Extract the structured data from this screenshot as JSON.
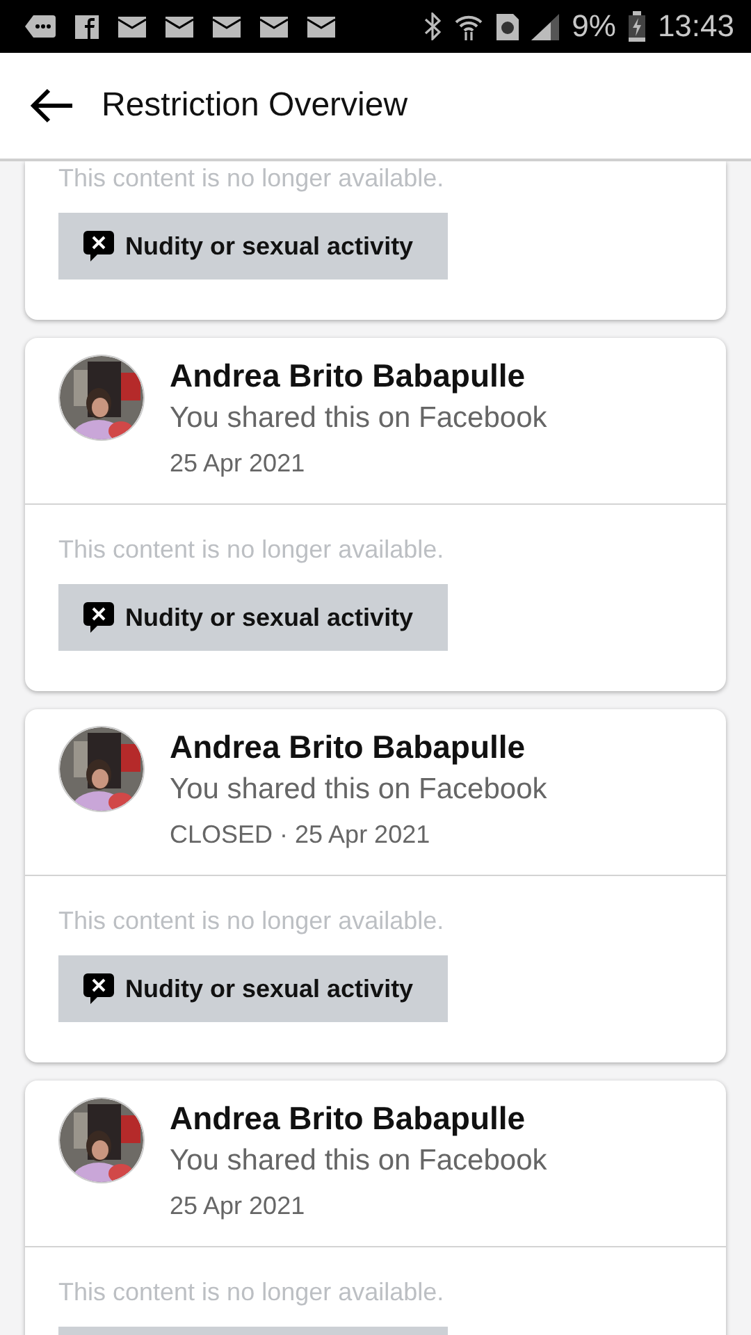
{
  "status_bar": {
    "battery": "9%",
    "time": "13:43"
  },
  "header": {
    "title": "Restriction Overview"
  },
  "cards": [
    {
      "cut_top": true,
      "content": "This content is no longer available.",
      "reason": "Nudity or sexual activity"
    },
    {
      "cut_top": false,
      "author": "Andrea Brito Babapulle",
      "subtitle": "You shared this on Facebook",
      "meta": "25 Apr 2021",
      "content": "This content is no longer available.",
      "reason": "Nudity or sexual activity"
    },
    {
      "cut_top": false,
      "author": "Andrea Brito Babapulle",
      "subtitle": "You shared this on Facebook",
      "meta": "CLOSED · 25 Apr 2021",
      "content": "This content is no longer available.",
      "reason": "Nudity or sexual activity"
    },
    {
      "cut_top": false,
      "author": "Andrea Brito Babapulle",
      "subtitle": "You shared this on Facebook",
      "meta": "25 Apr 2021",
      "content": "This content is no longer available."
    }
  ]
}
